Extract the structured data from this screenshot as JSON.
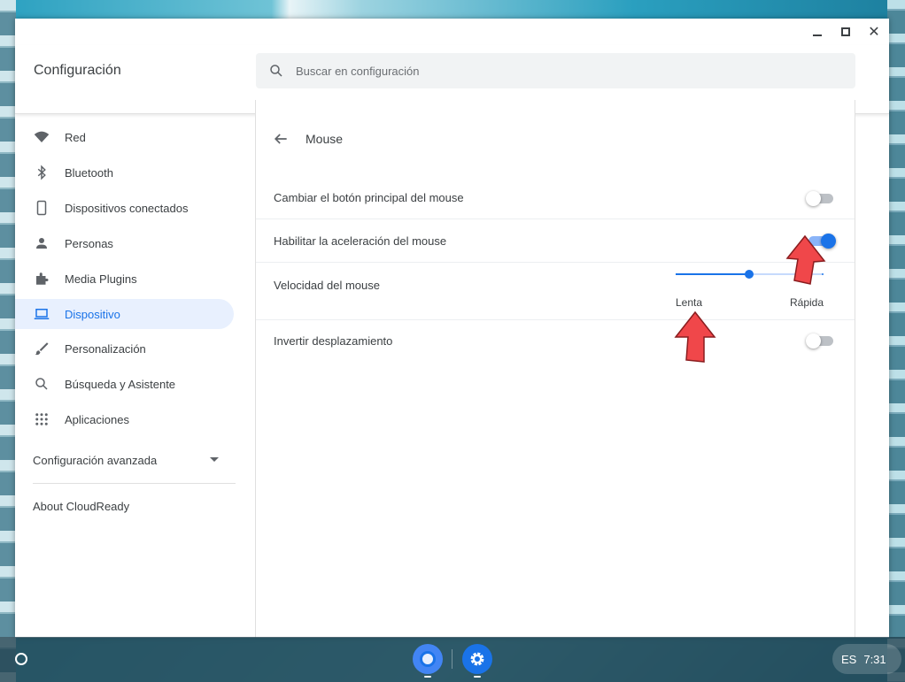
{
  "window": {
    "app_title": "Configuración",
    "search_placeholder": "Buscar en configuración"
  },
  "sidebar": {
    "items": [
      {
        "label": "Red",
        "icon": "wifi-icon",
        "active": false
      },
      {
        "label": "Bluetooth",
        "icon": "bluetooth-icon",
        "active": false
      },
      {
        "label": "Dispositivos conectados",
        "icon": "phone-icon",
        "active": false
      },
      {
        "label": "Personas",
        "icon": "person-icon",
        "active": false
      },
      {
        "label": "Media Plugins",
        "icon": "puzzle-icon",
        "active": false
      },
      {
        "label": "Dispositivo",
        "icon": "laptop-icon",
        "active": true
      },
      {
        "label": "Personalización",
        "icon": "brush-icon",
        "active": false
      },
      {
        "label": "Búsqueda y Asistente",
        "icon": "search-icon",
        "active": false
      },
      {
        "label": "Aplicaciones",
        "icon": "apps-grid-icon",
        "active": false
      }
    ],
    "advanced_label": "Configuración avanzada",
    "about_label": "About CloudReady"
  },
  "page": {
    "title": "Mouse",
    "rows": {
      "swap_primary": {
        "label": "Cambiar el botón principal del mouse",
        "enabled": false
      },
      "acceleration": {
        "label": "Habilitar la aceleración del mouse",
        "enabled": true
      },
      "speed": {
        "label": "Velocidad del mouse",
        "value_fraction": 0.5,
        "low_label": "Lenta",
        "high_label": "Rápida"
      },
      "reverse_scroll": {
        "label": "Invertir desplazamiento",
        "enabled": false
      }
    }
  },
  "shelf": {
    "apps": [
      "chrome-icon",
      "settings-gear-icon"
    ],
    "locale": "ES",
    "time": "7:31"
  },
  "colors": {
    "accent": "#1a73e8",
    "annotation_arrow": "#f0474a"
  }
}
